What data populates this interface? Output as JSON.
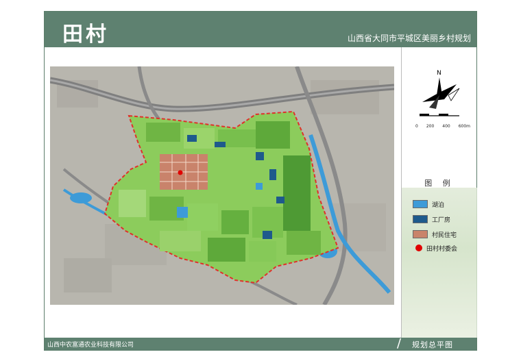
{
  "header": {
    "brand": "田村",
    "subtitle": "山西省大同市平城区美丽乡村规划"
  },
  "compass": {
    "north_label": "N",
    "scale_labels": [
      "0",
      "200",
      "400",
      "600m"
    ]
  },
  "legend": {
    "title": "图 例",
    "items": [
      {
        "label": "湖泊",
        "color": "#3d9bd8",
        "kind": "swatch"
      },
      {
        "label": "工厂房",
        "color": "#1e5a8c",
        "kind": "swatch"
      },
      {
        "label": "村民住宅",
        "color": "#c9836b",
        "kind": "swatch"
      },
      {
        "label": "田村村委会",
        "color": "#e00000",
        "kind": "dot"
      }
    ]
  },
  "footer": {
    "company": "山西中农富通农业科技有限公司",
    "sheet_title": "规划总平图"
  },
  "colors": {
    "frame_green": "#5e8170",
    "boundary_red": "#e0302a",
    "field_green": "#7cc24f",
    "road_gray": "#8a8a8a"
  }
}
